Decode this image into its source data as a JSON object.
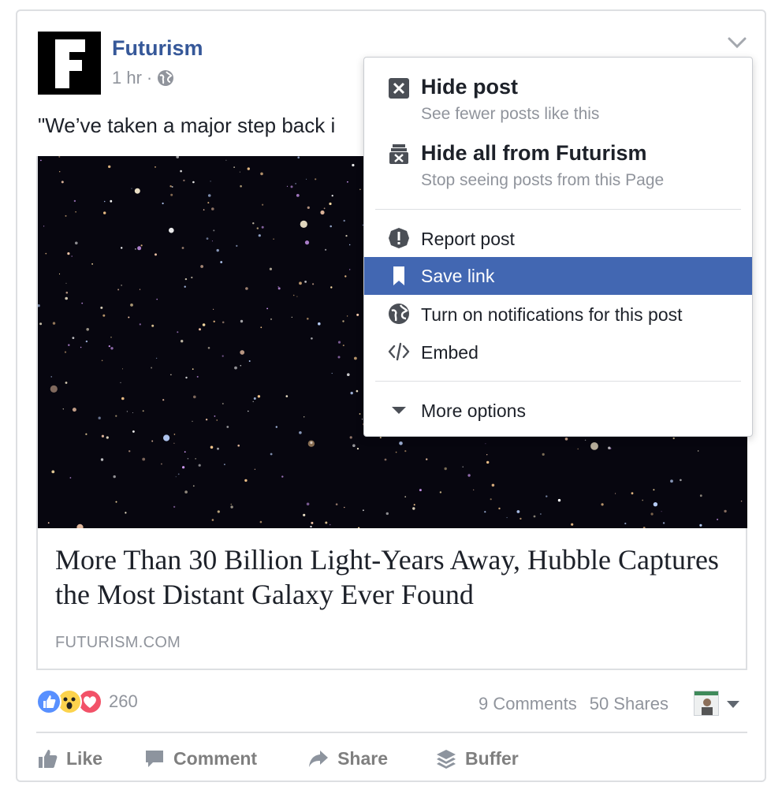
{
  "post": {
    "page_name": "Futurism",
    "time": "1 hr",
    "separator": "·",
    "text": "\"We’ve taken a major step back i"
  },
  "link_preview": {
    "title": "More Than 30 Billion Light-Years Away, Hubble Captures the Most Distant Galaxy Ever Found",
    "domain": "FUTURISM.COM"
  },
  "stats": {
    "reaction_count": "260",
    "comments": "9 Comments",
    "shares": "50 Shares"
  },
  "actions": {
    "like": "Like",
    "comment": "Comment",
    "share": "Share",
    "buffer": "Buffer"
  },
  "menu": {
    "hide_post": {
      "title": "Hide post",
      "subtitle": "See fewer posts like this"
    },
    "hide_all": {
      "title": "Hide all from Futurism",
      "subtitle": "Stop seeing posts from this Page"
    },
    "report": "Report post",
    "save": "Save link",
    "notifications": "Turn on notifications for this post",
    "embed": "Embed",
    "more": "More options"
  },
  "icons": {
    "avatar": "futurism-logo-icon",
    "privacy": "globe-icon",
    "menu_toggle": "chevron-down-icon"
  },
  "colors": {
    "link_blue": "#365899",
    "highlight": "#4267b2",
    "secondary_text": "#90949c",
    "border": "#dddfe2"
  }
}
